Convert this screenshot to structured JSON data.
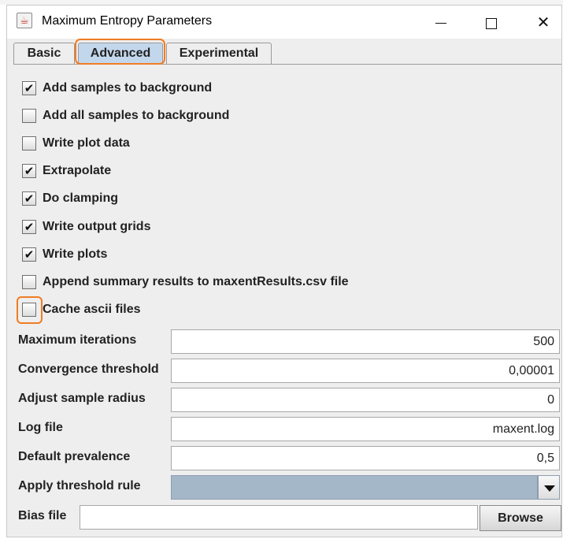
{
  "window": {
    "title": "Maximum Entropy Parameters",
    "icon": "java-app-icon",
    "controls": [
      "minimize",
      "maximize",
      "close"
    ]
  },
  "tabs": [
    {
      "label": "Basic",
      "selected": false
    },
    {
      "label": "Advanced",
      "selected": true
    },
    {
      "label": "Experimental",
      "selected": false
    }
  ],
  "checkboxes": [
    {
      "label": "Add samples to background",
      "checked": true
    },
    {
      "label": "Add all samples to background",
      "checked": false
    },
    {
      "label": "Write plot data",
      "checked": false
    },
    {
      "label": "Extrapolate",
      "checked": true
    },
    {
      "label": "Do clamping",
      "checked": true
    },
    {
      "label": "Write output grids",
      "checked": true
    },
    {
      "label": "Write plots",
      "checked": true
    },
    {
      "label": "Append summary results to maxentResults.csv file",
      "checked": false
    },
    {
      "label": "Cache ascii files",
      "checked": false
    }
  ],
  "fields": [
    {
      "label": "Maximum iterations",
      "value": "500"
    },
    {
      "label": "Convergence threshold",
      "value": "0,00001"
    },
    {
      "label": "Adjust sample radius",
      "value": "0"
    },
    {
      "label": "Log file",
      "value": "maxent.log"
    },
    {
      "label": "Default prevalence",
      "value": "0,5"
    }
  ],
  "threshold": {
    "label": "Apply threshold rule",
    "value": ""
  },
  "bias": {
    "label": "Bias file",
    "value": "",
    "browse_label": "Browse"
  },
  "colors": {
    "highlight": "#f07d22",
    "selected_tab": "#c3d7ec",
    "combo_bg": "#a4b7c9"
  }
}
